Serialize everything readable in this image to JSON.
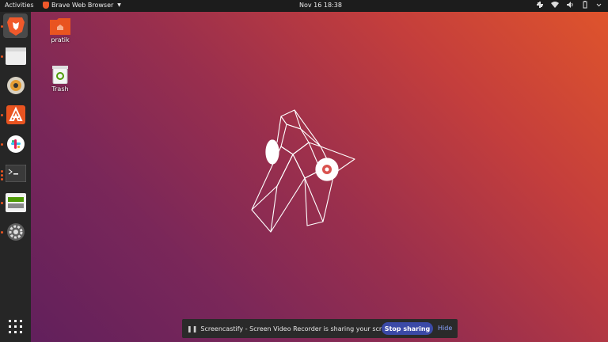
{
  "topbar": {
    "activities": "Activities",
    "app_name": "Brave Web Browser",
    "datetime": "Nov 16  18:38"
  },
  "dock": {
    "items": [
      {
        "name": "brave-browser",
        "icon": "brave-lion-icon"
      },
      {
        "name": "files",
        "icon": "folder-icon"
      },
      {
        "name": "rhythmbox",
        "icon": "speaker-icon"
      },
      {
        "name": "software",
        "icon": "app-store-icon"
      },
      {
        "name": "slack",
        "icon": "slack-icon"
      },
      {
        "name": "terminal",
        "icon": "terminal-icon"
      },
      {
        "name": "system-monitor",
        "icon": "monitor-icon"
      },
      {
        "name": "settings",
        "icon": "gear-icon"
      }
    ],
    "show_apps_icon": "grid-icon"
  },
  "desktop": {
    "icons": [
      {
        "label": "pratik",
        "icon": "home-folder-icon"
      },
      {
        "label": "Trash",
        "icon": "trash-icon"
      }
    ]
  },
  "notification": {
    "message": "Screencastify - Screen Video Recorder is sharing your screen.",
    "stop_label": "Stop sharing",
    "hide_label": "Hide"
  },
  "colors": {
    "accent": "#e95420",
    "topbar": "#1c1c1c",
    "dock": "#262626",
    "stop_button": "#3b4aa7"
  }
}
